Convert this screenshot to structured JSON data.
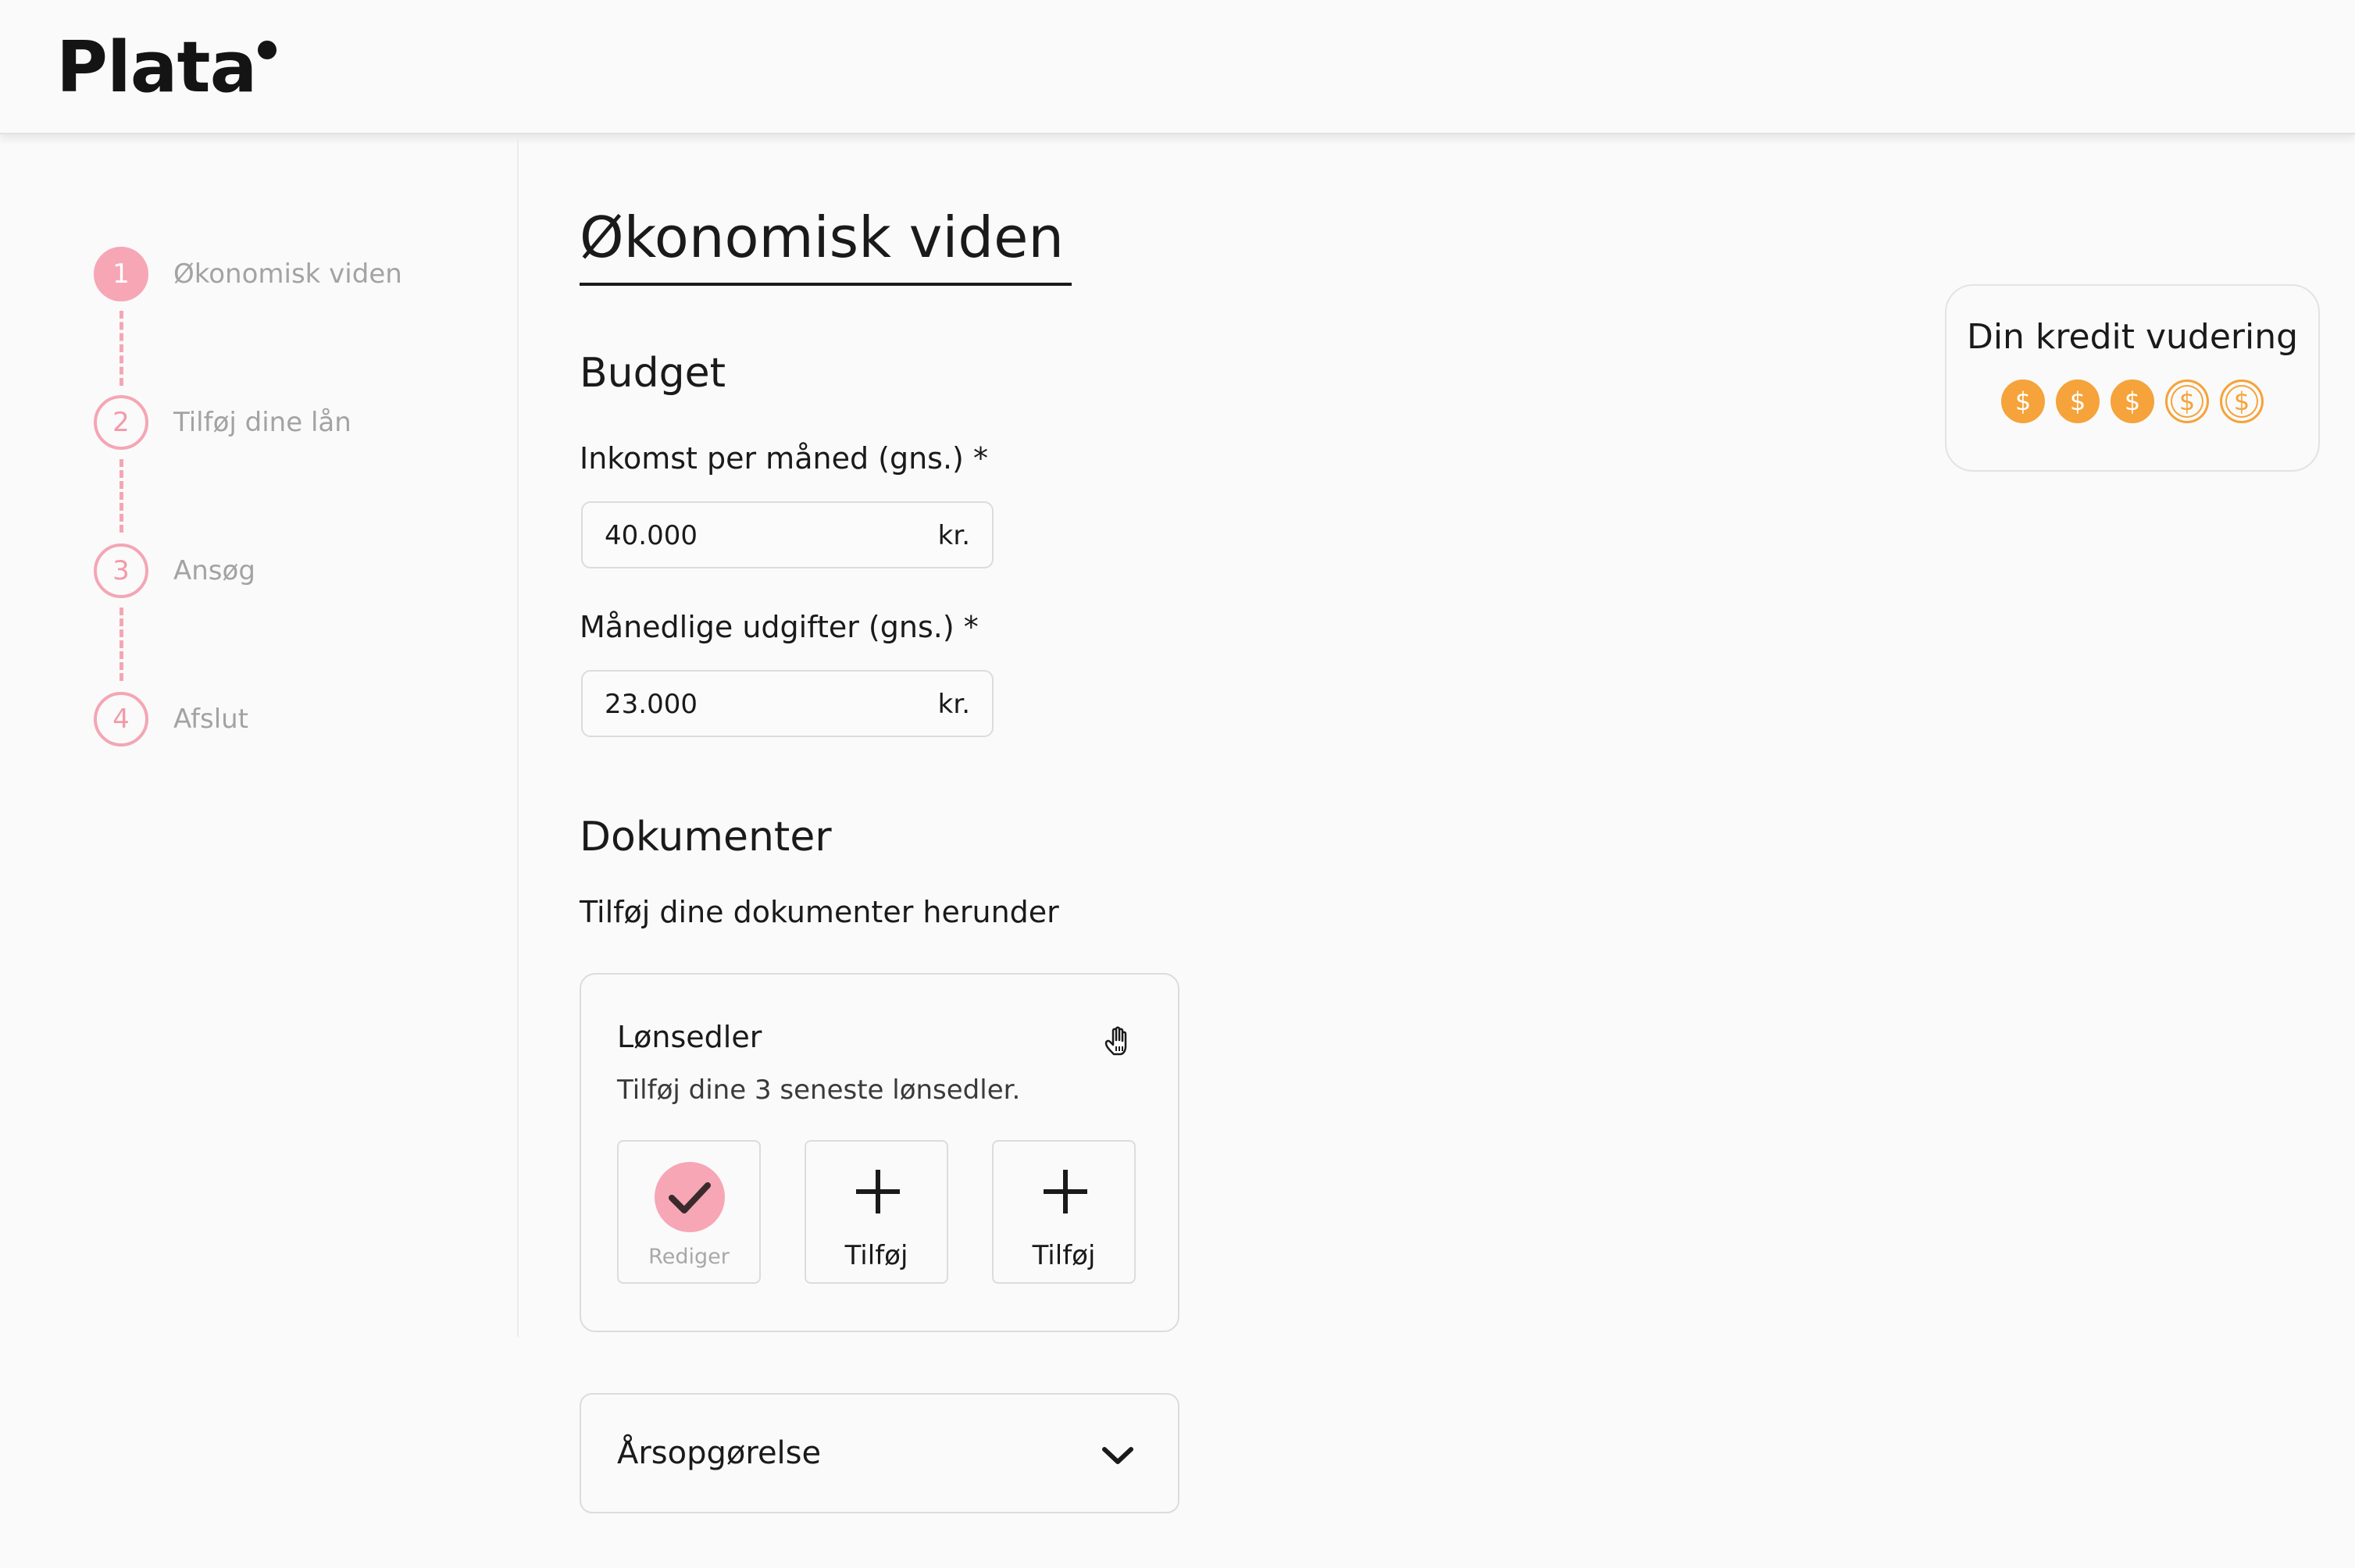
{
  "app": {
    "logo": "Plata"
  },
  "stepper": {
    "steps": [
      {
        "number": "1",
        "label": "Økonomisk viden",
        "active": true
      },
      {
        "number": "2",
        "label": "Tilføj dine lån",
        "active": false
      },
      {
        "number": "3",
        "label": "Ansøg",
        "active": false
      },
      {
        "number": "4",
        "label": "Afslut",
        "active": false
      }
    ]
  },
  "main": {
    "title": "Økonomisk viden",
    "budget": {
      "heading": "Budget",
      "income": {
        "label": "Inkomst per måned (gns.) *",
        "value": "40.000",
        "unit": "kr."
      },
      "expenses": {
        "label": "Månedlige udgifter (gns.) *",
        "value": "23.000",
        "unit": "kr."
      }
    },
    "documents": {
      "heading": "Dokumenter",
      "subtitle": "Tilføj dine dokumenter herunder",
      "payslips": {
        "title": "Lønsedler",
        "description": "Tilføj dine 3 seneste lønsedler.",
        "slots": [
          {
            "state": "done",
            "label": "Rediger"
          },
          {
            "state": "empty",
            "label": "Tilføj"
          },
          {
            "state": "empty",
            "label": "Tilføj"
          }
        ]
      },
      "annual_statement": {
        "title": "Årsopgørelse"
      }
    }
  },
  "credit_rating": {
    "title": "Din kredit vudering",
    "coin_symbol": "$",
    "score": 3,
    "max": 5,
    "accent": "#f5a33a"
  },
  "colors": {
    "pink": "#f7a6b5",
    "orange": "#f5a33a"
  }
}
